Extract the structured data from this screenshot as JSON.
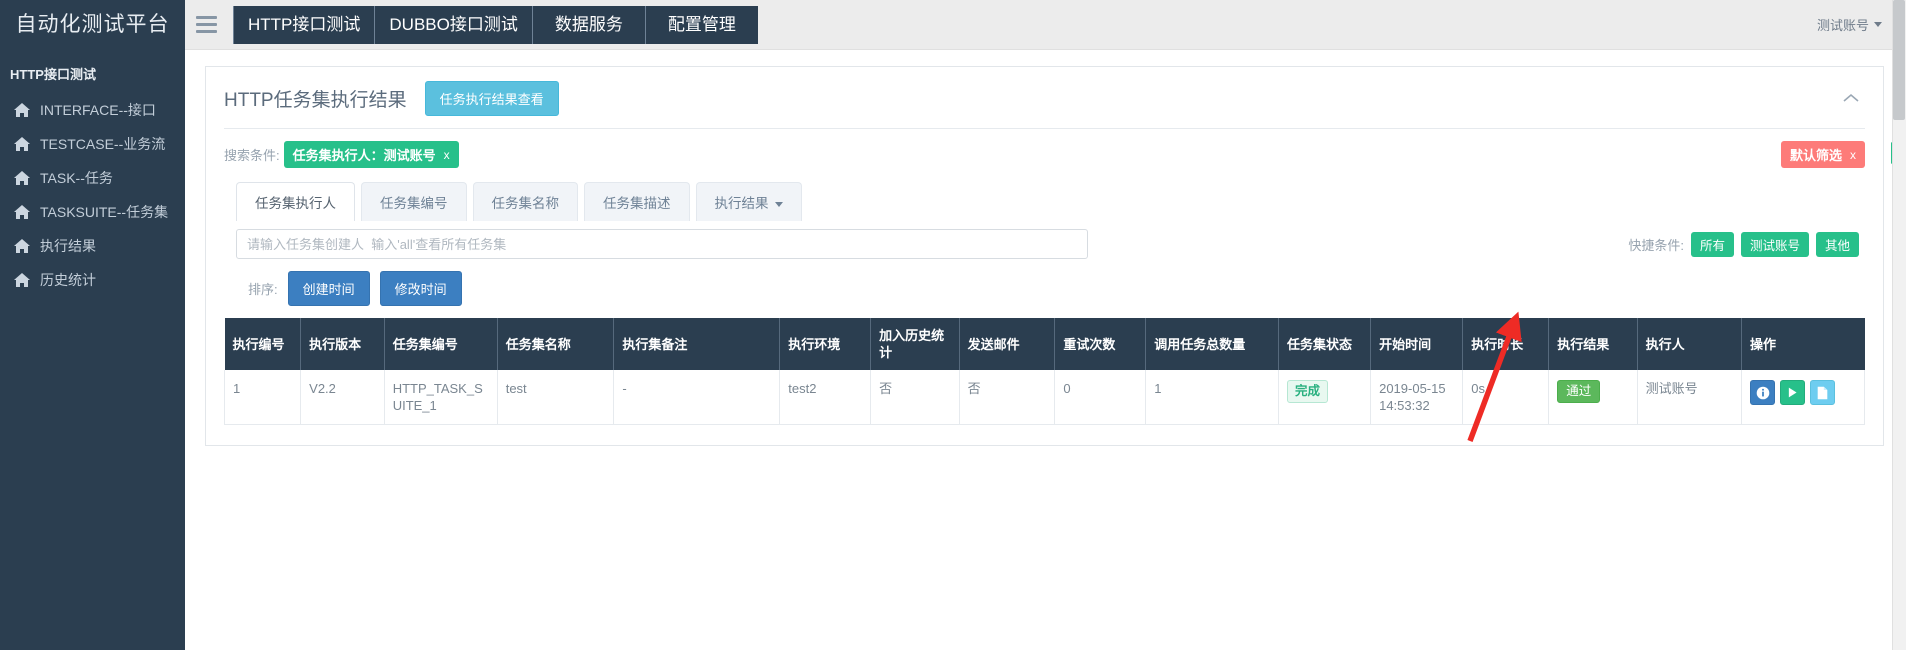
{
  "sidebar": {
    "brand": "自动化测试平台",
    "section_title": "HTTP接口测试",
    "items": [
      {
        "icon": "home-icon",
        "label": "INTERFACE--接口"
      },
      {
        "icon": "home-icon",
        "label": "TESTCASE--业务流"
      },
      {
        "icon": "home-icon",
        "label": "TASK--任务"
      },
      {
        "icon": "home-icon",
        "label": "TASKSUITE--任务集"
      },
      {
        "icon": "home-icon",
        "label": "执行结果"
      },
      {
        "icon": "home-icon",
        "label": "历史统计"
      }
    ]
  },
  "navbar": {
    "menu_icon": "hamburger-icon",
    "tabs": [
      {
        "label": "HTTP接口测试"
      },
      {
        "label": "DUBBO接口测试"
      },
      {
        "label": "数据服务"
      },
      {
        "label": "配置管理"
      }
    ],
    "user": "测试账号"
  },
  "panel": {
    "title": "HTTP任务集执行结果",
    "view_button": "任务执行结果查看",
    "collapse_icon": "chevron-up-icon"
  },
  "search": {
    "label": "搜索条件:",
    "tag": "任务集执行人：测试账号",
    "tag_close": "x",
    "filter_tag": "默认筛选",
    "filter_close": "x"
  },
  "tabs": [
    {
      "label": "任务集执行人",
      "active": true,
      "dropdown": false
    },
    {
      "label": "任务集编号",
      "active": false,
      "dropdown": false
    },
    {
      "label": "任务集名称",
      "active": false,
      "dropdown": false
    },
    {
      "label": "任务集描述",
      "active": false,
      "dropdown": false
    },
    {
      "label": "执行结果",
      "active": false,
      "dropdown": true
    }
  ],
  "input": {
    "value": "",
    "placeholder": "请输入任务集创建人  输入'all'查看所有任务集"
  },
  "quick": {
    "label": "快捷条件:",
    "badges": [
      "所有",
      "测试账号",
      "其他"
    ]
  },
  "sort": {
    "label": "排序:",
    "buttons": [
      "创建时间",
      "修改时间"
    ]
  },
  "table": {
    "columns": [
      "执行编号",
      "执行版本",
      "任务集编号",
      "任务集名称",
      "执行集备注",
      "执行环境",
      "加入历史统计",
      "发送邮件",
      "重试次数",
      "调用任务总数量",
      "任务集状态",
      "开始时间",
      "执行时长",
      "执行结果",
      "执行人",
      "操作"
    ],
    "rows": [
      {
        "exec_no": "1",
        "exec_version": "V2.2",
        "suite_no": "HTTP_TASK_SUITE_1",
        "suite_name": "test",
        "suite_remark": "-",
        "env": "test2",
        "join_history": "否",
        "send_mail": "否",
        "retry_count": "0",
        "task_total": "1",
        "suite_status": "完成",
        "start_time": "2019-05-15 14:53:32",
        "duration": "0s",
        "result": "通过",
        "executor": "测试账号",
        "ops": [
          "info-icon",
          "play-icon",
          "document-icon"
        ]
      }
    ]
  },
  "colors": {
    "sidebar_bg": "#2b3e50",
    "accent_green": "#27c08a",
    "accent_blue": "#3c7fc1",
    "accent_cyan": "#5bc0de",
    "accent_red": "#fd7b79",
    "annotation_arrow": "#ee2b25"
  }
}
